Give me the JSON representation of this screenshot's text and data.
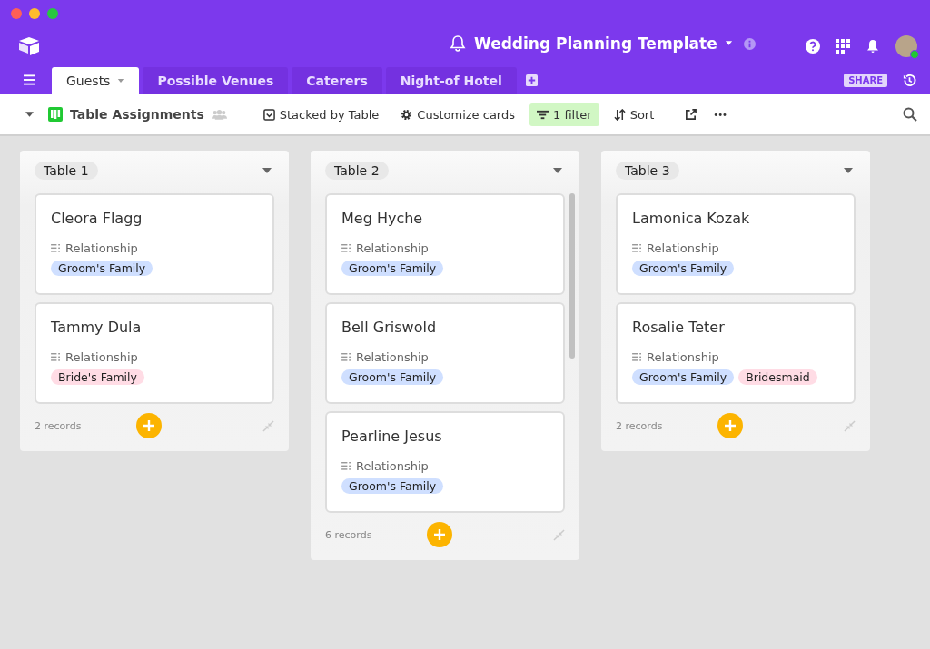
{
  "base": {
    "title": "Wedding Planning Template"
  },
  "tabs": [
    {
      "label": "Guests",
      "selected": true
    },
    {
      "label": "Possible Venues",
      "selected": false
    },
    {
      "label": "Caterers",
      "selected": false
    },
    {
      "label": "Night-of Hotel",
      "selected": false
    }
  ],
  "share": "SHARE",
  "toolbar": {
    "view": "Table Assignments",
    "stacked": "Stacked by Table",
    "customize": "Customize cards",
    "filter": "1 filter",
    "sort": "Sort",
    "more": "•••"
  },
  "stacks": [
    {
      "title": "Table 1",
      "count": "2 records",
      "cards": [
        {
          "name": "Cleora Flagg",
          "field": "Relationship",
          "tags": [
            {
              "label": "Groom's Family",
              "color": "#cfdfff"
            }
          ]
        },
        {
          "name": "Tammy Dula",
          "field": "Relationship",
          "tags": [
            {
              "label": "Bride's Family",
              "color": "#ffdce5"
            }
          ]
        }
      ]
    },
    {
      "title": "Table 2",
      "count": "6 records",
      "cards": [
        {
          "name": "Meg Hyche",
          "field": "Relationship",
          "tags": [
            {
              "label": "Groom's Family",
              "color": "#cfdfff"
            }
          ]
        },
        {
          "name": "Bell Griswold",
          "field": "Relationship",
          "tags": [
            {
              "label": "Groom's Family",
              "color": "#cfdfff"
            }
          ]
        },
        {
          "name": "Pearline Jesus",
          "field": "Relationship",
          "tags": [
            {
              "label": "Groom's Family",
              "color": "#cfdfff"
            }
          ]
        }
      ]
    },
    {
      "title": "Table 3",
      "count": "2 records",
      "cards": [
        {
          "name": "Lamonica Kozak",
          "field": "Relationship",
          "tags": [
            {
              "label": "Groom's Family",
              "color": "#cfdfff"
            }
          ]
        },
        {
          "name": "Rosalie Teter",
          "field": "Relationship",
          "tags": [
            {
              "label": "Groom's Family",
              "color": "#cfdfff"
            },
            {
              "label": "Bridesmaid",
              "color": "#ffdce5"
            }
          ]
        }
      ]
    }
  ]
}
